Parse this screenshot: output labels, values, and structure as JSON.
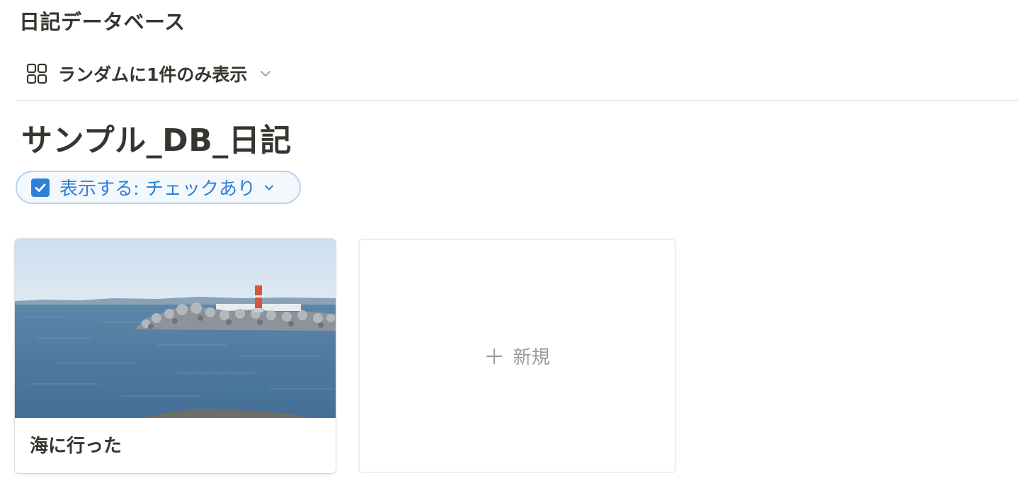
{
  "header": {
    "title": "日記データベース"
  },
  "view": {
    "icon": "gallery-grid-icon",
    "label": "ランダムに1件のみ表示"
  },
  "database": {
    "title": "サンプル_DB_日記"
  },
  "filter": {
    "label": "表示する: チェックあり",
    "checked": true,
    "accent_color": "#2f80d9"
  },
  "gallery": {
    "cards": [
      {
        "title": "海に行った",
        "cover": "sea-breakwater-lighthouse-photo"
      }
    ],
    "new_label": "新規"
  }
}
